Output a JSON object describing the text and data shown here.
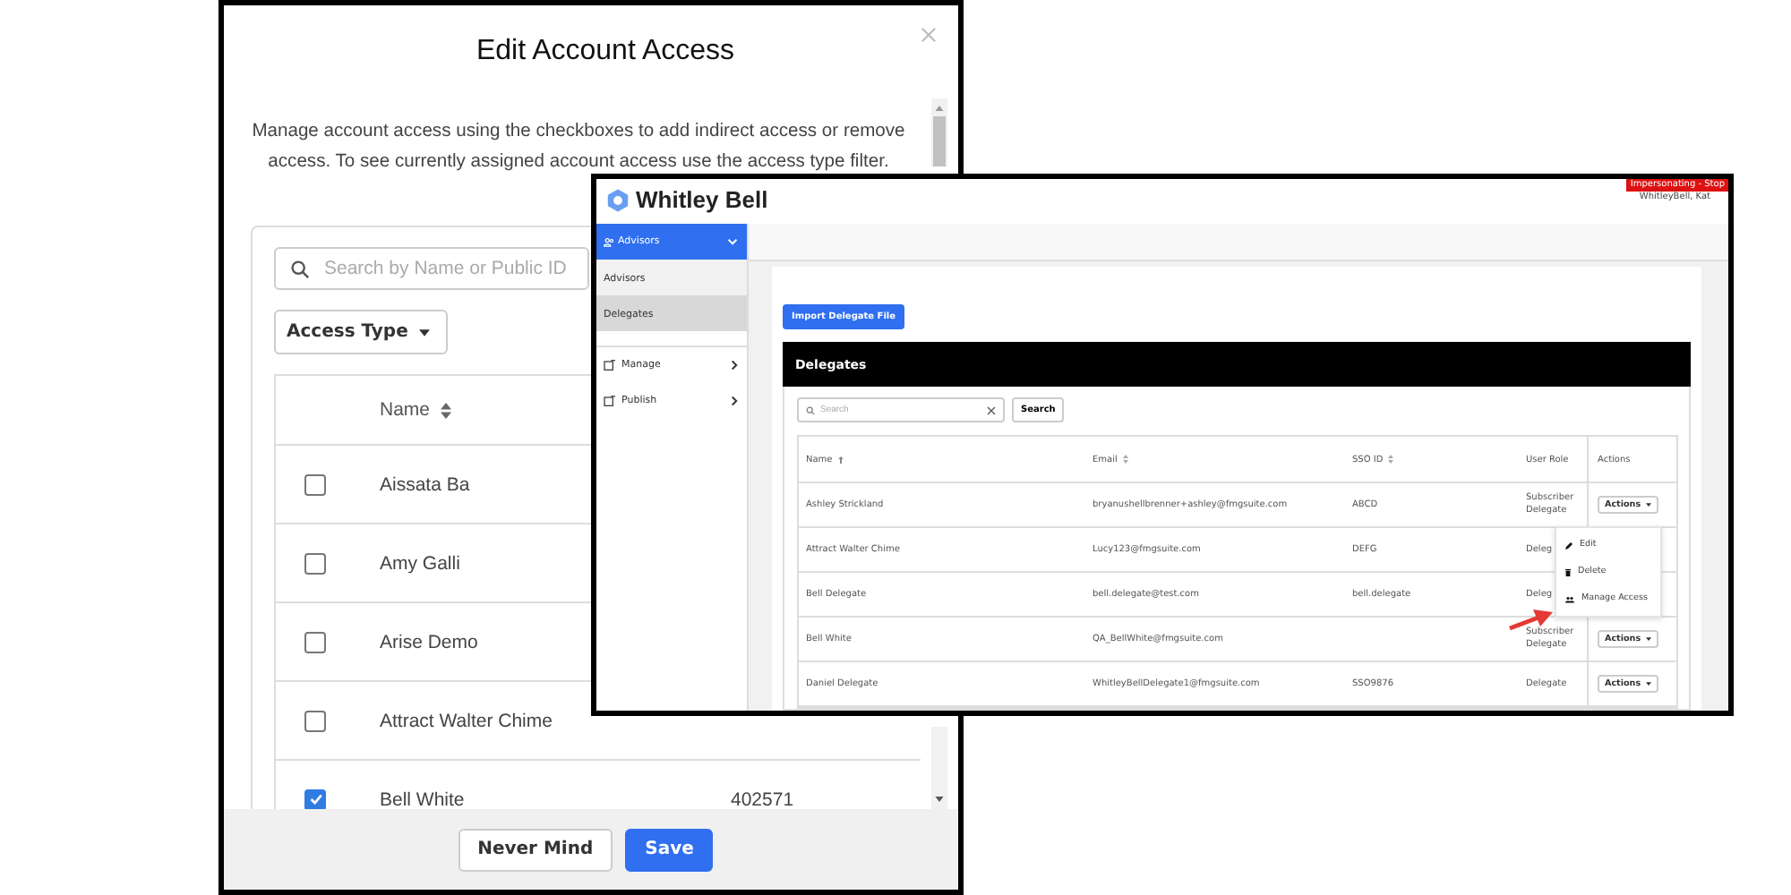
{
  "edit_dialog": {
    "title": "Edit Account Access",
    "description": "Manage account access using the checkboxes to add indirect access or remove access. To see currently assigned account access use the access type filter.",
    "search": {
      "placeholder": "Search by Name or Public ID"
    },
    "filter": {
      "label": "Access Type"
    },
    "columns": [
      {
        "label": "Name",
        "sortable": true
      }
    ],
    "rows": [
      {
        "name": "Aissata Ba",
        "checked": false
      },
      {
        "name": "Amy Galli",
        "checked": false
      },
      {
        "name": "Arise Demo",
        "checked": false
      },
      {
        "name": "Attract Walter Chime",
        "checked": false
      },
      {
        "name": "Bell White",
        "public_id": "402571",
        "checked": true
      }
    ],
    "buttons": [
      {
        "label": "Never Mind",
        "kind": "secondary"
      },
      {
        "label": "Save",
        "kind": "primary"
      }
    ]
  },
  "app": {
    "brand": "Whitley Bell",
    "impersonation": "Impersonating - Stop",
    "user": "WhitleyBell, Kat",
    "nav_header": "Advisors",
    "sidebar": {
      "items": [
        {
          "label": "Advisors",
          "kind": "sub",
          "selected": false
        },
        {
          "label": "Delegates",
          "kind": "sub",
          "selected": true
        },
        {
          "label": "Manage",
          "kind": "group",
          "selected": false
        },
        {
          "label": "Publish",
          "kind": "group",
          "selected": false
        }
      ]
    },
    "import_button": "Import Delegate File",
    "panel_title": "Delegates",
    "search": {
      "placeholder": "Search"
    },
    "search_button": "Search",
    "columns": [
      {
        "label": "Name",
        "sortable": true,
        "sorted": true
      },
      {
        "label": "Email",
        "sortable": true,
        "sorted": false
      },
      {
        "label": "SSO ID",
        "sortable": true,
        "sorted": false
      },
      {
        "label": "User Role",
        "sortable": false
      },
      {
        "label": "Actions",
        "sortable": false
      }
    ],
    "rows": [
      {
        "name": "Ashley Strickland",
        "email": "bryanushellbrenner+ashley@fmgsuite.com",
        "sso_id": "ABCD",
        "role": "Subscriber Delegate",
        "action": "Actions"
      },
      {
        "name": "Attract Walter Chime",
        "email": "Lucy123@fmgsuite.com",
        "sso_id": "DEFG",
        "role": "Deleg"
      },
      {
        "name": "Bell Delegate",
        "email": "bell.delegate@test.com",
        "sso_id": "bell.delegate",
        "role": "Deleg"
      },
      {
        "name": "Bell White",
        "email": "QA_BellWhite@fmgsuite.com",
        "role": "Subscriber Delegate",
        "action": "Actions"
      },
      {
        "name": "Daniel Delegate",
        "email": "WhitleyBellDelegate1@fmgsuite.com",
        "sso_id": "SSO9876",
        "role": "Delegate",
        "action": "Actions"
      }
    ],
    "menu": {
      "items": [
        {
          "label": "Edit",
          "kind": "edit"
        },
        {
          "label": "Delete",
          "kind": "delete"
        },
        {
          "label": "Manage Access",
          "kind": "people"
        }
      ]
    }
  }
}
